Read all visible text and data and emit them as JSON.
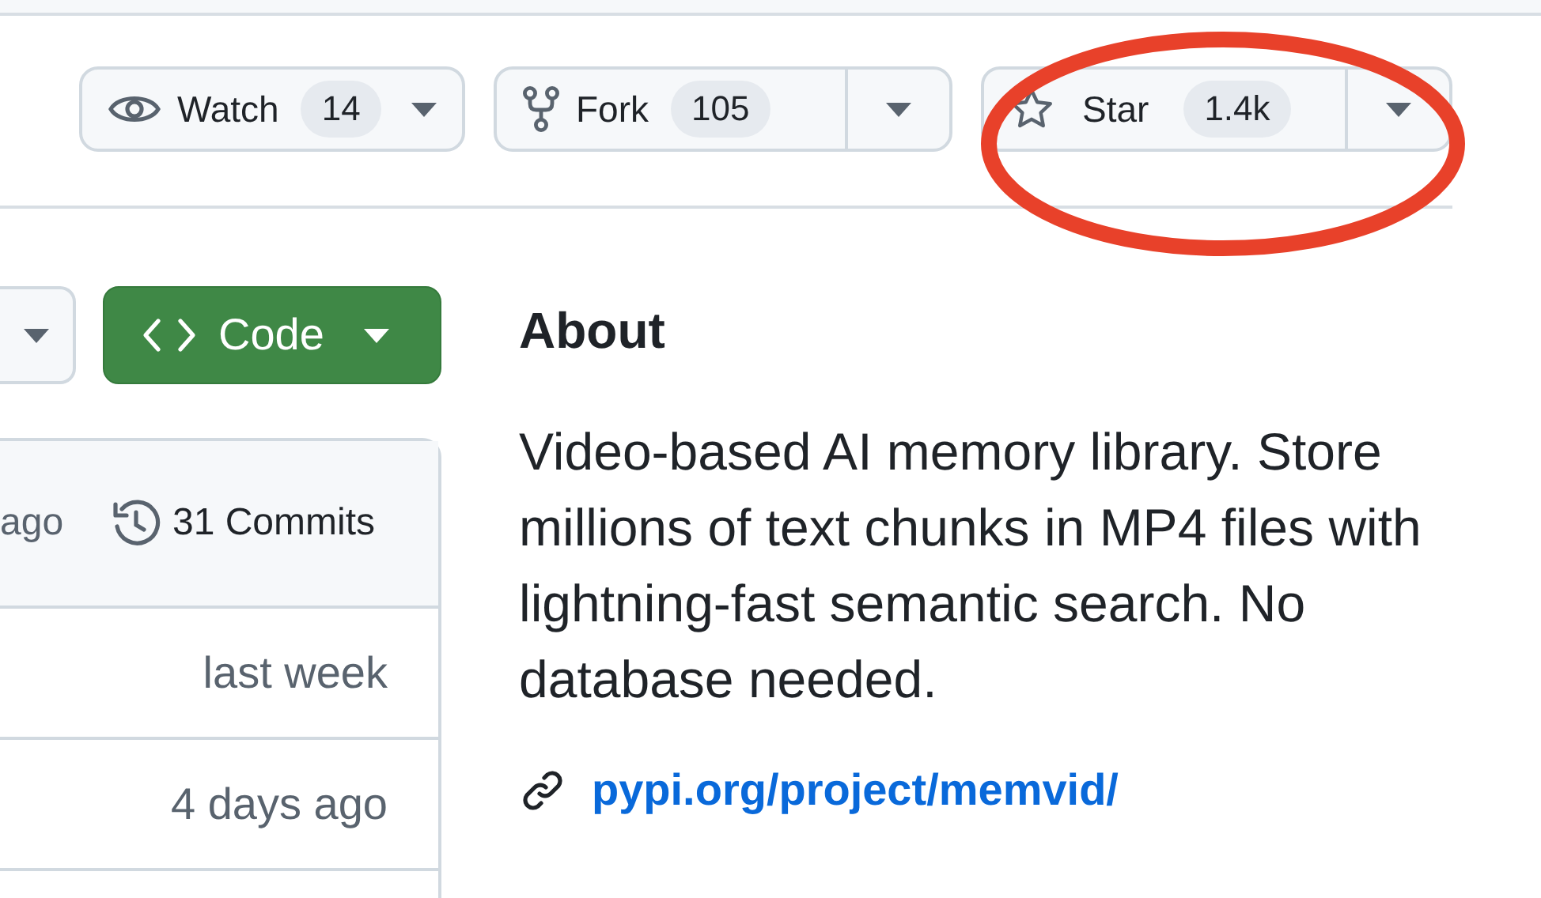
{
  "repo_actions": [
    {
      "kind": "watch",
      "label": "Watch",
      "count": "14",
      "split": false
    },
    {
      "kind": "fork",
      "label": "Fork",
      "count": "105",
      "split": true
    },
    {
      "kind": "star",
      "label": "Star",
      "count": "1.4k",
      "split": true
    }
  ],
  "code_button": {
    "label": "Code"
  },
  "commits": {
    "last_commit_time": "ago",
    "commit_count": "31 Commits",
    "rows": [
      {
        "time": "last week"
      },
      {
        "time": "4 days ago"
      }
    ]
  },
  "about": {
    "heading": "About",
    "description": "Video-based AI memory library. Store millions of text chunks in MP4 files with lightning-fast semantic search. No database needed.",
    "link": "pypi.org/project/memvid/"
  },
  "annotation": {
    "kind": "ellipse"
  }
}
